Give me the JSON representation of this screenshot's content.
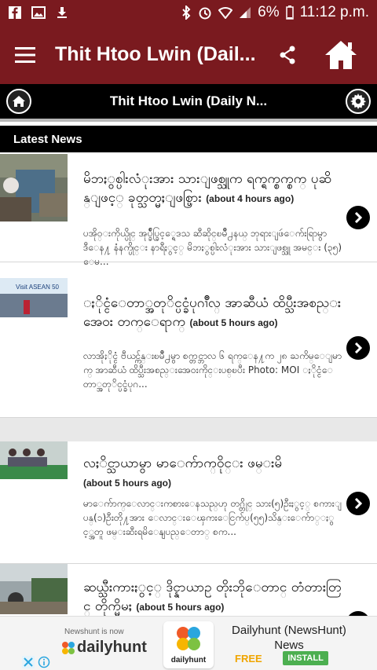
{
  "status_bar": {
    "battery": "6%",
    "time": "11:12 p.m."
  },
  "app_bar": {
    "title": "Thit Htoo Lwin (Dail...",
    "icons": {
      "menu": "hamburger-menu-icon",
      "share": "share-icon",
      "home": "home-icon"
    }
  },
  "sub_bar": {
    "title": "Thit Htoo Lwin (Daily N...",
    "icons": {
      "home": "home-icon",
      "settings": "gear-icon"
    }
  },
  "section": {
    "title": "Latest News"
  },
  "news": [
    {
      "title": "မိဘႏွစ္ပါးလံုးအား သားျဖစ္သူက ရက္ရက္စက္စက္ ပုဆိန္ျဖင့္ ခုတ္သတ္မႈျဖစ္ပြား",
      "time": "(about 4 hours ago)",
      "excerpt": "ပအိုဝ္းကိုယ္ပိုင္ အုပ္ခ်ဳပ္ခြင့္ရေဒသ ဆီဆိုင္ၿမိဳ႕နယ္ ဘုရားျဖဴေက်းရြာမွာ ဒီေန႔ နံနက္ပိုင္း နာရီႏွင့္ မိဘႏွစ္ပါးလံုးအား သားျဖစ္သူ အမင္း (၃၅) ေမ..."
    },
    {
      "title": "ႏိုင္ငံေတာ္အတုိင္ပင္ခံပုဂၢိဳလ္ အာဆီယံ ထိပ္သီးအစည္းအေဝး တက္ေရာက္",
      "time": "(about 5 hours ago)",
      "excerpt": "လာအိုႏိုင္ငံ ဗီယင္က်န္းၿမိဳ႕မွာ စက္တင္ဘာလ ၆ ရက္ေန႔က ၂၈ ႀကိမ္ေျမာက္ အာဆီယံ ထိပ္သီးအစည္းအေဝးကိုင္းပစ္ၿပီး Photo: MOI ႏိုင္ငံေတာ္အတုိင္ပင္ခံပုဂ..."
    },
    {
      "title": "လႈိင္သာယာမွာ မာေက်ာက္ဝိုင္း ဖမ္းမိ",
      "time": "(about 5 hours ago)",
      "excerpt": "မာေက်ာက္ေလာင္းကစားေနသည္ဟု တဂ္တိုင္ သား(၅)ဦးႏွင့္ စကားျပန္(၁)ဦးတို႔အား ေလာင္းေၾကးေငြက်ပ္(၅၅)သိန္းေက်ာ္ႏွင့္အတူ ဖမ္းဆီးရမိေနျပည္ေတာ္ စက..."
    },
    {
      "title": "ဆယ္သီးကားႏွင့္ ဒိုင္နာယာဥ္ တိုးဘိုေတာင္ တံတားတြင္ တိုက္မိမႈ",
      "time": "(about 5 hours ago)",
      "excerpt": ""
    }
  ],
  "ad": {
    "brand_small": "Newshunt is now",
    "brand": "dailyhunt",
    "app_label": "dailyhunt",
    "title": "Dailyhunt (NewsHunt) News",
    "free": "FREE",
    "install": "INSTALL"
  },
  "colors": {
    "primary": "#7a1a1f",
    "black": "#000000",
    "install_green": "#4caf50",
    "free_orange": "#f0a500"
  }
}
